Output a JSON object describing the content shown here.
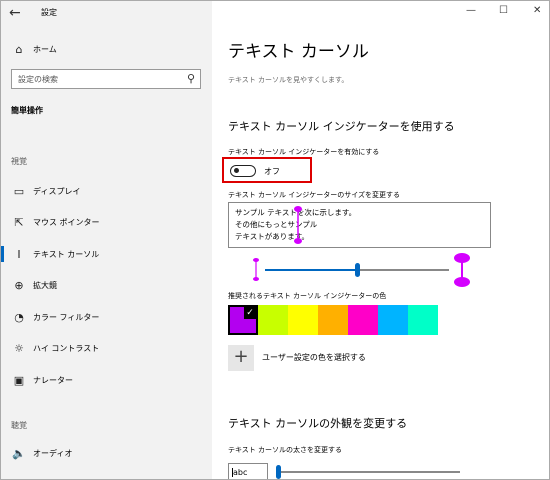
{
  "window": {
    "title": "設定",
    "controls": [
      "—",
      "☐",
      "✕"
    ]
  },
  "sidebar": {
    "home_label": "ホーム",
    "search_placeholder": "設定の検索",
    "section_title": "簡単操作",
    "groups": [
      {
        "label": "視覚",
        "items": [
          {
            "label": "ディスプレイ",
            "icon": "display-icon",
            "glyph": "▭"
          },
          {
            "label": "マウス ポインター",
            "icon": "mouse-pointer-icon",
            "glyph": "⇱"
          },
          {
            "label": "テキスト カーソル",
            "icon": "text-cursor-icon",
            "glyph": "I",
            "active": true
          },
          {
            "label": "拡大鏡",
            "icon": "magnifier-icon",
            "glyph": "⊕"
          },
          {
            "label": "カラー フィルター",
            "icon": "color-filter-icon",
            "glyph": "◔"
          },
          {
            "label": "ハイ コントラスト",
            "icon": "high-contrast-icon",
            "glyph": "☼"
          },
          {
            "label": "ナレーター",
            "icon": "narrator-icon",
            "glyph": "▣"
          }
        ]
      },
      {
        "label": "聴覚",
        "items": [
          {
            "label": "オーディオ",
            "icon": "audio-icon",
            "glyph": "🔈"
          }
        ]
      }
    ]
  },
  "main": {
    "title": "テキスト カーソル",
    "subtitle": "テキスト カーソルを見やすくします。",
    "indicator_section": {
      "heading": "テキスト カーソル インジケーターを使用する",
      "toggle_label": "テキスト カーソル インジケーターを有効にする",
      "toggle_state": "オフ",
      "toggle_on": false,
      "size_label": "テキスト カーソル インジケーターのサイズを変更する",
      "preview_lines": [
        "サンプル テキストを次に示します。",
        "その他にもっとサンプル",
        "テキストがあります。"
      ],
      "size_level": 0.5,
      "colors_label": "推奨されるテキスト カーソル インジケーターの色",
      "colors": [
        "#b300f0",
        "#c8ff00",
        "#ffff00",
        "#ffb000",
        "#ff00c8",
        "#00b4ff",
        "#00ffc8"
      ],
      "selected_color_index": 0,
      "custom_color_label": "ユーザー設定の色を選択する",
      "indicator_color": "#d400ff"
    },
    "appearance_section": {
      "heading": "テキスト カーソルの外観を変更する",
      "thickness_label": "テキスト カーソルの太さを変更する",
      "sample_text": "abc",
      "thickness_level": 0.0
    }
  },
  "accent": "#0067c0"
}
